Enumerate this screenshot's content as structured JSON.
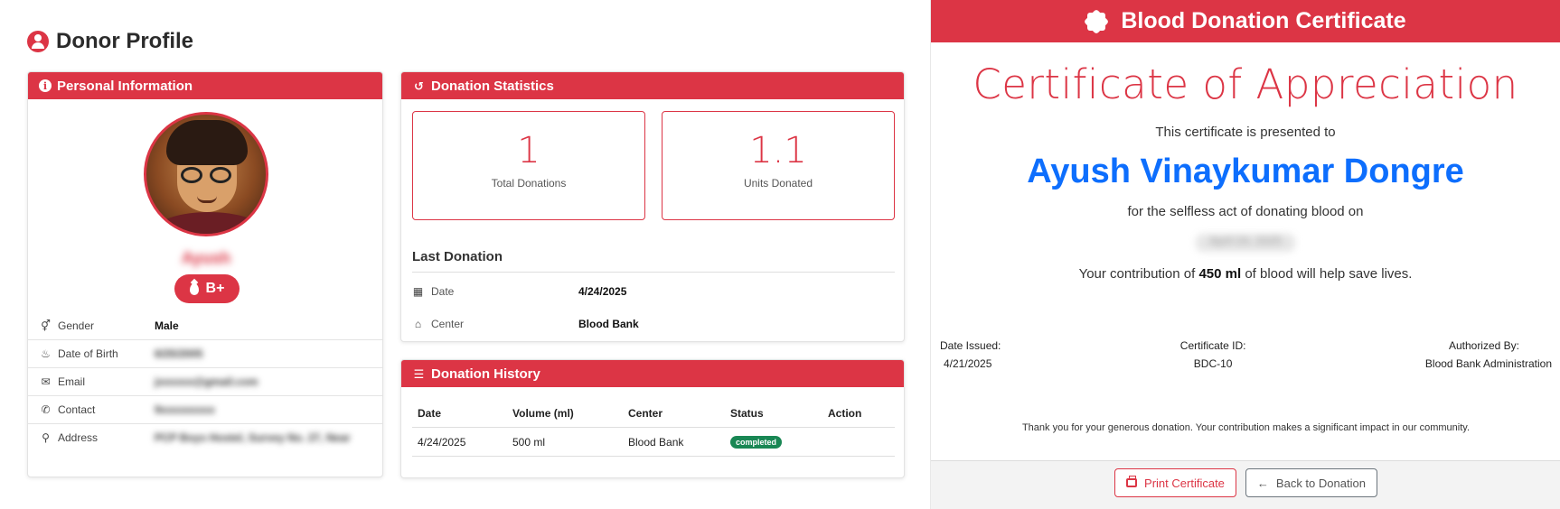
{
  "profile": {
    "title": "Donor Profile",
    "personal": {
      "header": "Personal Information",
      "name": "Ayush",
      "blood_group": "B+",
      "rows": [
        {
          "label": "Gender",
          "value": "Male"
        },
        {
          "label": "Date of Birth",
          "value": "6/25/2005"
        },
        {
          "label": "Email",
          "value": "jxxxxxx@gmail.com"
        },
        {
          "label": "Contact",
          "value": "9xxxxxxxxx"
        },
        {
          "label": "Address",
          "value": "PCP Boys Hostel, Survey No. 27, Near"
        }
      ]
    },
    "stats": {
      "header": "Donation Statistics",
      "total_donations": "1",
      "total_label": "Total Donations",
      "units_donated": "1.1",
      "units_label": "Units Donated",
      "last_title": "Last Donation",
      "date_label": "Date",
      "date_value": "4/24/2025",
      "center_label": "Center",
      "center_value": "Blood Bank"
    },
    "history": {
      "header": "Donation History",
      "columns": [
        "Date",
        "Volume (ml)",
        "Center",
        "Status",
        "Action"
      ],
      "rows": [
        {
          "date": "4/24/2025",
          "volume": "500 ml",
          "center": "Blood Bank",
          "status": "completed",
          "action": ""
        }
      ]
    }
  },
  "certificate": {
    "header": "Blood Donation Certificate",
    "title": "Certificate of Appreciation",
    "presented": "This certificate is presented to",
    "recipient": "Ayush Vinaykumar Dongre",
    "for_text": "for the selfless act of donating blood on",
    "donation_date": "April 24, 2025",
    "contrib_prefix": "Your contribution of ",
    "contrib_amount": "450 ml",
    "contrib_suffix": " of blood will help save lives.",
    "date_issued_label": "Date Issued:",
    "date_issued": "4/21/2025",
    "cert_id_label": "Certificate ID:",
    "cert_id": "BDC-10",
    "authorized_label": "Authorized By:",
    "authorized": "Blood Bank Administration",
    "thanks": "Thank you for your generous donation. Your contribution makes a significant impact in our community.",
    "print_label": "Print Certificate",
    "back_label": "Back to Donation"
  },
  "colors": {
    "accent": "#dc3545",
    "name_blue": "#0d6efd",
    "success": "#198754"
  }
}
